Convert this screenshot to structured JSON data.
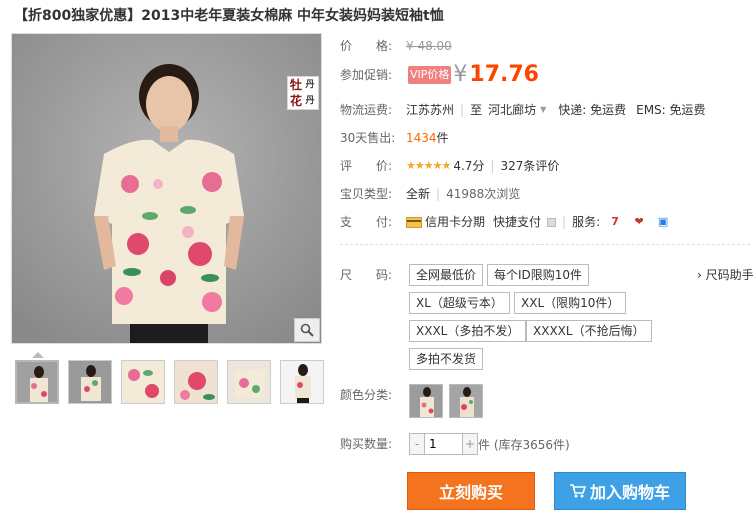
{
  "title": "【折800独家优惠】2013中老年夏装女棉麻 中年女装妈妈装短袖t恤",
  "gallery": {
    "seal_chars": [
      "牡",
      "丹",
      "花",
      "丹"
    ],
    "zoom_icon": "magnifier-icon"
  },
  "price": {
    "label": "价　　格:",
    "original": "¥ 48.00",
    "promo_label": "参加促销:",
    "vip_tag": "VIP价格",
    "yen": "¥",
    "value": "17.76"
  },
  "shipping": {
    "label": "物流运费:",
    "from": "江苏苏州",
    "to_prefix": "至",
    "to": "河北廊坊",
    "express": "快递: 免运费",
    "ems": "EMS: 免运费"
  },
  "sales": {
    "label": "30天售出:",
    "count": "1434",
    "unit": "件"
  },
  "rating": {
    "label": "评　　价:",
    "stars": "★★★★★",
    "score": "4.7分",
    "reviews": "327条评价"
  },
  "item_type": {
    "label": "宝贝类型:",
    "condition": "全新",
    "views": "41988次浏览"
  },
  "payment": {
    "label": "支　　付:",
    "card": "信用卡分期",
    "quick": "快捷支付",
    "service_label": "服务:"
  },
  "sizes": {
    "label": "尺　　码:",
    "help": "› 尺码助手",
    "options": [
      "全网最低价",
      "每个ID限购10件",
      "XL（超级亏本）",
      "XXL（限购10件）",
      "XXXL（多拍不发）",
      "XXXXL（不抢后悔）",
      "多拍不发货"
    ]
  },
  "colors": {
    "label": "颜色分类:"
  },
  "quantity": {
    "label": "购买数量:",
    "value": "1",
    "minus": "-",
    "plus": "+",
    "stock": "件 (库存3656件)"
  },
  "actions": {
    "buy": "立刻购买",
    "cart": "加入购物车"
  }
}
